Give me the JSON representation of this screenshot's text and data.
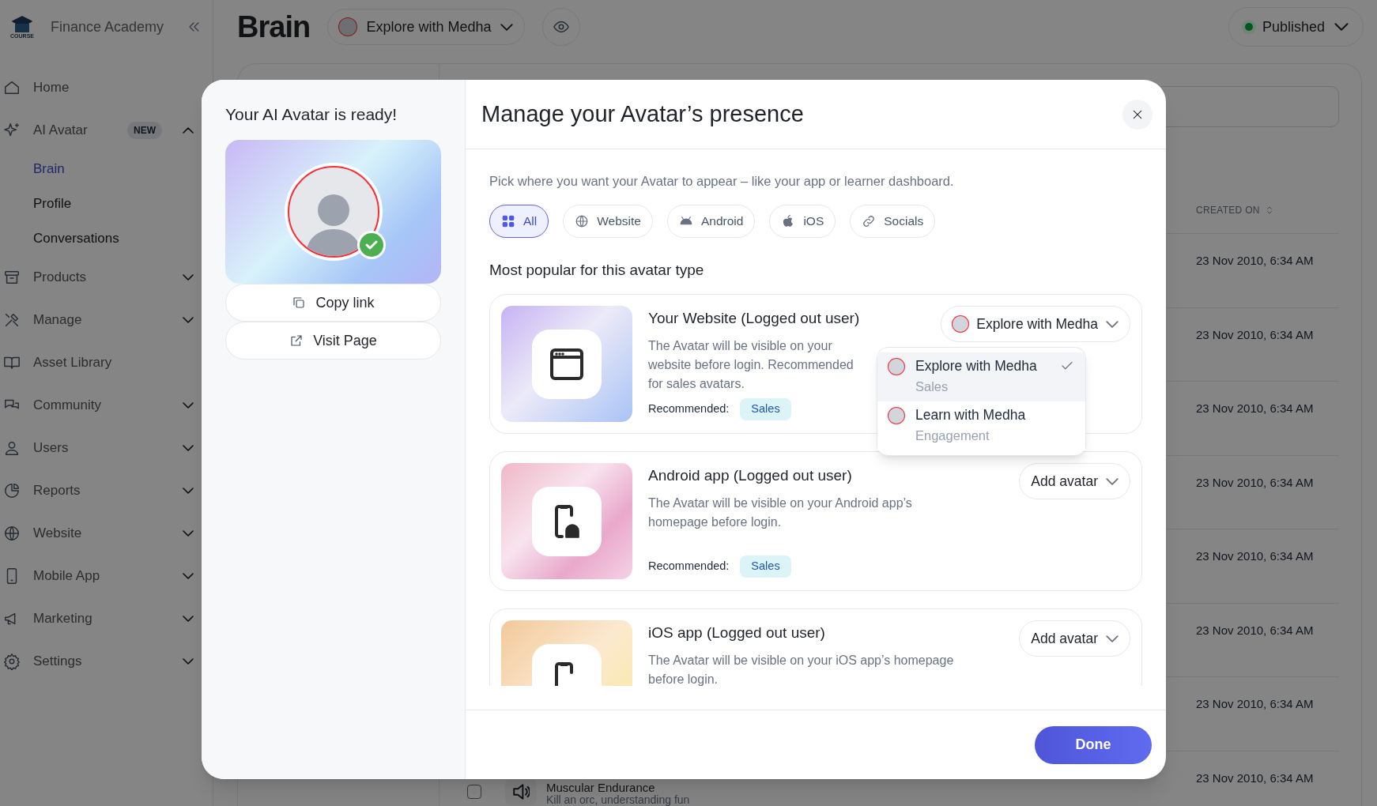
{
  "sidebar": {
    "brand": "Finance Academy",
    "logo_text": "COURSE",
    "items": [
      {
        "label": "Home"
      },
      {
        "label": "AI Avatar",
        "badge": "NEW",
        "expanded": true,
        "children": [
          {
            "label": "Brain",
            "selected": true
          },
          {
            "label": "Profile",
            "selected": false
          },
          {
            "label": "Conversations",
            "selected": false
          }
        ]
      },
      {
        "label": "Products",
        "expanded": false
      },
      {
        "label": "Manage",
        "expanded": false
      },
      {
        "label": "Asset Library"
      },
      {
        "label": "Community",
        "expanded": false
      },
      {
        "label": "Users",
        "expanded": false
      },
      {
        "label": "Reports",
        "expanded": false
      },
      {
        "label": "Website",
        "expanded": false
      },
      {
        "label": "Mobile App",
        "expanded": false
      },
      {
        "label": "Marketing",
        "expanded": false
      },
      {
        "label": "Settings",
        "expanded": false
      }
    ]
  },
  "header": {
    "title": "Brain",
    "avatar_select": "Explore with Medha",
    "status": "Published"
  },
  "table": {
    "column": "CREATED ON",
    "rows": [
      {
        "created_on": "23 Nov 2010, 6:34 AM"
      },
      {
        "created_on": "23 Nov 2010, 6:34 AM"
      },
      {
        "created_on": "23 Nov 2010, 6:34 AM"
      },
      {
        "created_on": "23 Nov 2010, 6:34 AM"
      },
      {
        "created_on": "23 Nov 2010, 6:34 AM"
      },
      {
        "created_on": "23 Nov 2010, 6:34 AM"
      },
      {
        "created_on": "23 Nov 2010, 6:34 AM"
      },
      {
        "created_on": "23 Nov 2010, 6:34 AM",
        "title": "Muscular Endurance",
        "subtitle": "Kill an orc, understanding fun",
        "checked": false
      }
    ]
  },
  "modal": {
    "left": {
      "title": "Your AI Avatar is ready!",
      "verified": true,
      "actions": [
        "Copy link",
        "Visit Page"
      ]
    },
    "title": "Manage your Avatar’s presence",
    "description": "Pick where you want your Avatar to appear – like your app or learner dashboard.",
    "filters": [
      {
        "label": "All",
        "selected": true
      },
      {
        "label": "Website",
        "selected": false
      },
      {
        "label": "Android",
        "selected": false
      },
      {
        "label": "iOS",
        "selected": false
      },
      {
        "label": "Socials",
        "selected": false
      }
    ],
    "section_title": "Most popular for this avatar type",
    "placements": [
      {
        "kind": "website",
        "title": "Your Website (Logged out user)",
        "description": "The Avatar will be visible on your website before login. Recommended for sales avatars.",
        "recommended_label": "Recommended:",
        "tag": "Sales",
        "select": "Explore with Medha",
        "menu": [
          {
            "name": "Explore with Medha",
            "role": "Sales",
            "selected": true
          },
          {
            "name": "Learn with Medha",
            "role": "Engagement",
            "selected": false
          }
        ]
      },
      {
        "kind": "android",
        "title": "Android app (Logged out user)",
        "description": "The Avatar will be visible on your Android app’s homepage before login.",
        "recommended_label": "Recommended:",
        "tag": "Sales",
        "select": "Add avatar"
      },
      {
        "kind": "ios",
        "title": "iOS app (Logged out user)",
        "description": "The Avatar will be visible on your iOS app’s homepage before login.",
        "select": "Add avatar"
      }
    ],
    "done": "Done"
  }
}
